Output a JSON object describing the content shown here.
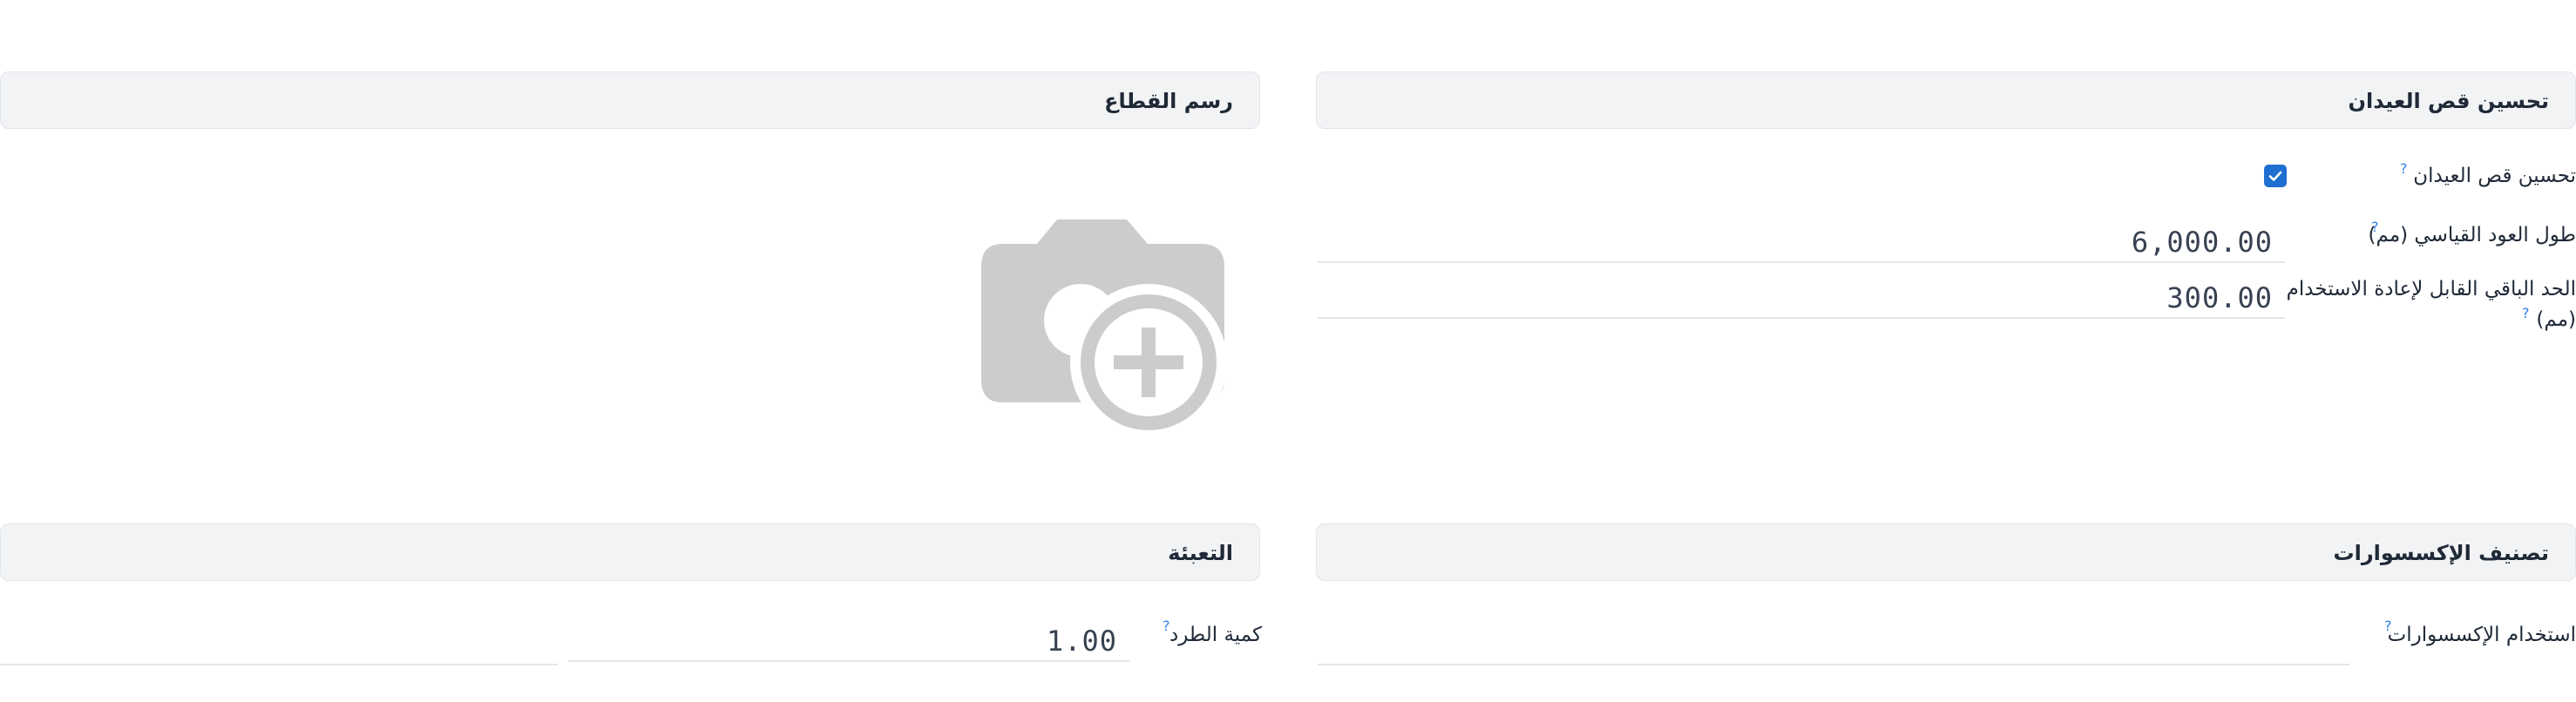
{
  "sections": {
    "bar_optimization": {
      "title": "تحسين قص العيدان"
    },
    "section_drawing": {
      "title": "رسم القطاع"
    },
    "accessory_classification": {
      "title": "تصنيف الإكسسوارات"
    },
    "packaging": {
      "title": "التعبئة"
    }
  },
  "fields": {
    "optimize_bars": {
      "label": "تحسين قص العيدان",
      "help": "?",
      "checked": true
    },
    "standard_bar_length": {
      "label": "طول العود القياسي (مم)",
      "help": "?",
      "value": "6,000.00"
    },
    "min_reusable_remnant": {
      "label_line1": "الحد الباقي القابل لإعادة الاستخدام",
      "label_line2": "(مم)",
      "help": "?",
      "value": "300.00"
    },
    "accessory_usage": {
      "label": "استخدام الإكسسوارات",
      "help": "?",
      "value": ""
    },
    "package_quantity": {
      "label": "كمية الطرد",
      "help": "?",
      "value": "1.00"
    }
  },
  "icons": {
    "image_placeholder": "camera-plus-icon",
    "checkbox_check": "check-icon"
  },
  "colors": {
    "header_bg": "#f2f3f5",
    "accent_blue": "#1f6fd1",
    "help_blue": "#2f80ed",
    "placeholder_gray": "#cccccc"
  }
}
